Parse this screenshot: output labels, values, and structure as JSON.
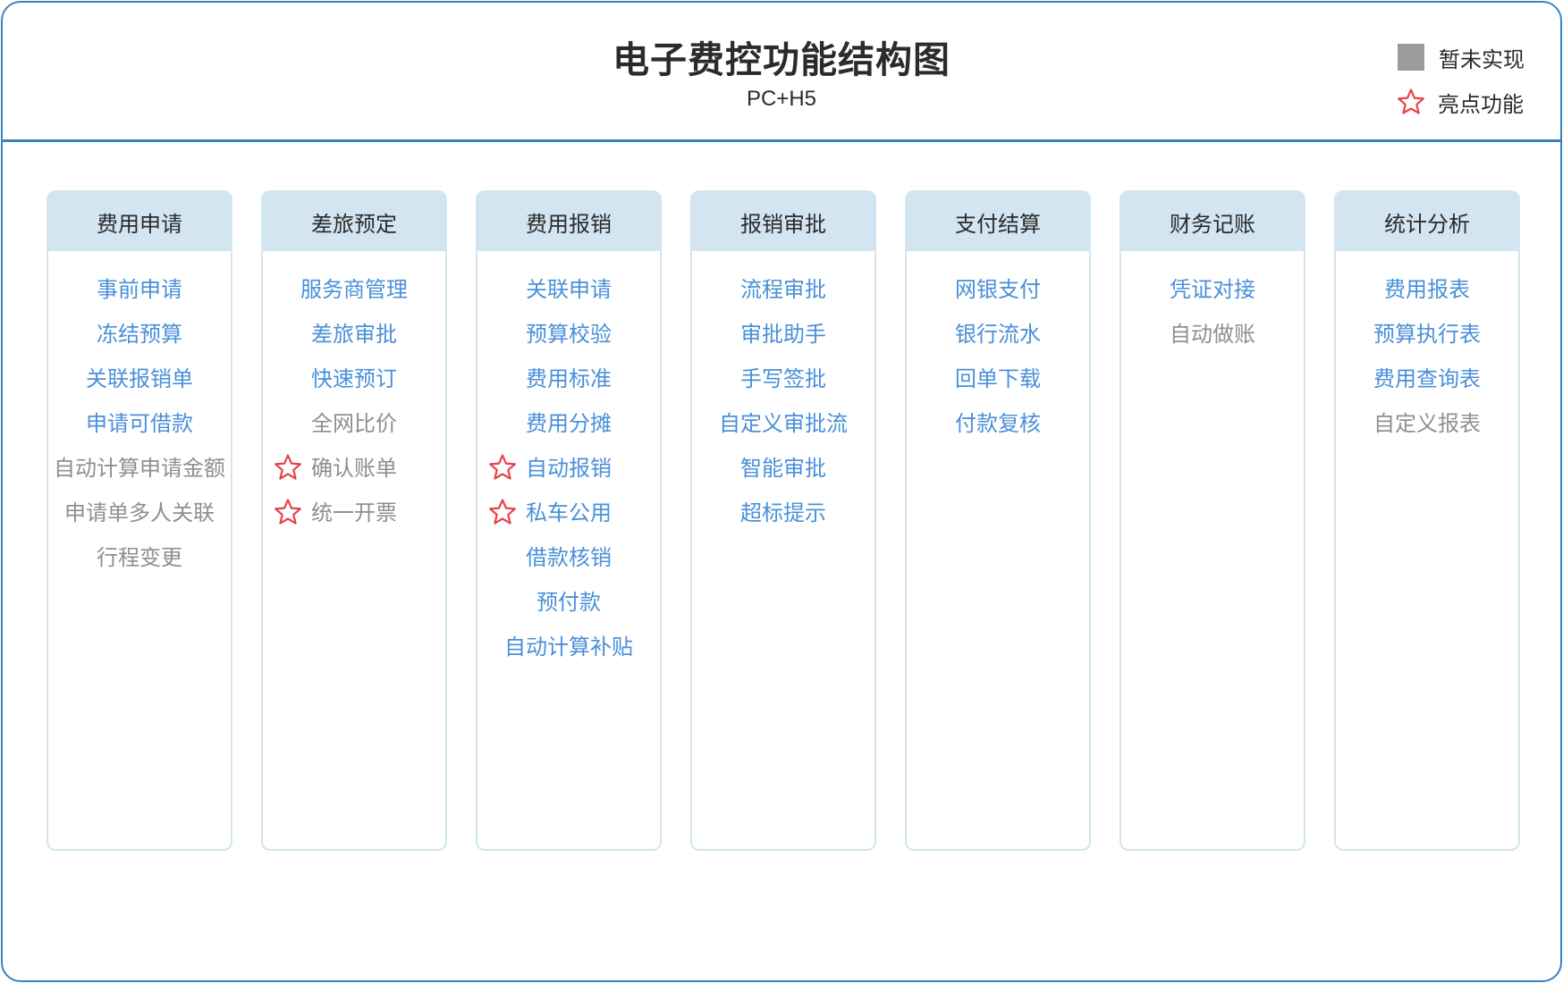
{
  "title": "电子费控功能结构图",
  "subtitle": "PC+H5",
  "legend": {
    "not_implemented": "暂未实现",
    "highlight": "亮点功能"
  },
  "colors": {
    "border": "#3a82c4",
    "column_header_bg": "#d2e5f0",
    "implemented_text": "#4a90d9",
    "not_implemented_text": "#8f8f8f",
    "not_implemented_swatch": "#9b9b9b",
    "star": "#e8414b"
  },
  "columns": [
    {
      "title": "费用申请",
      "items": [
        {
          "label": "事前申请",
          "implemented": true,
          "highlight": false
        },
        {
          "label": "冻结预算",
          "implemented": true,
          "highlight": false
        },
        {
          "label": "关联报销单",
          "implemented": true,
          "highlight": false
        },
        {
          "label": "申请可借款",
          "implemented": true,
          "highlight": false
        },
        {
          "label": "自动计算申请金额",
          "implemented": false,
          "highlight": false
        },
        {
          "label": "申请单多人关联",
          "implemented": false,
          "highlight": false
        },
        {
          "label": "行程变更",
          "implemented": false,
          "highlight": false
        }
      ]
    },
    {
      "title": "差旅预定",
      "items": [
        {
          "label": "服务商管理",
          "implemented": true,
          "highlight": false
        },
        {
          "label": "差旅审批",
          "implemented": true,
          "highlight": false
        },
        {
          "label": "快速预订",
          "implemented": true,
          "highlight": false
        },
        {
          "label": "全网比价",
          "implemented": false,
          "highlight": false
        },
        {
          "label": "确认账单",
          "implemented": false,
          "highlight": true
        },
        {
          "label": "统一开票",
          "implemented": false,
          "highlight": true
        }
      ]
    },
    {
      "title": "费用报销",
      "items": [
        {
          "label": "关联申请",
          "implemented": true,
          "highlight": false
        },
        {
          "label": "预算校验",
          "implemented": true,
          "highlight": false
        },
        {
          "label": "费用标准",
          "implemented": true,
          "highlight": false
        },
        {
          "label": "费用分摊",
          "implemented": true,
          "highlight": false
        },
        {
          "label": "自动报销",
          "implemented": true,
          "highlight": true
        },
        {
          "label": "私车公用",
          "implemented": true,
          "highlight": true
        },
        {
          "label": "借款核销",
          "implemented": true,
          "highlight": false
        },
        {
          "label": "预付款",
          "implemented": true,
          "highlight": false
        },
        {
          "label": "自动计算补贴",
          "implemented": true,
          "highlight": false
        }
      ]
    },
    {
      "title": "报销审批",
      "items": [
        {
          "label": "流程审批",
          "implemented": true,
          "highlight": false
        },
        {
          "label": "审批助手",
          "implemented": true,
          "highlight": false
        },
        {
          "label": "手写签批",
          "implemented": true,
          "highlight": false
        },
        {
          "label": "自定义审批流",
          "implemented": true,
          "highlight": false
        },
        {
          "label": "智能审批",
          "implemented": true,
          "highlight": false
        },
        {
          "label": "超标提示",
          "implemented": true,
          "highlight": false
        }
      ]
    },
    {
      "title": "支付结算",
      "items": [
        {
          "label": "网银支付",
          "implemented": true,
          "highlight": false
        },
        {
          "label": "银行流水",
          "implemented": true,
          "highlight": false
        },
        {
          "label": "回单下载",
          "implemented": true,
          "highlight": false
        },
        {
          "label": "付款复核",
          "implemented": true,
          "highlight": false
        }
      ]
    },
    {
      "title": "财务记账",
      "items": [
        {
          "label": "凭证对接",
          "implemented": true,
          "highlight": false
        },
        {
          "label": "自动做账",
          "implemented": false,
          "highlight": false
        }
      ]
    },
    {
      "title": "统计分析",
      "items": [
        {
          "label": "费用报表",
          "implemented": true,
          "highlight": false
        },
        {
          "label": "预算执行表",
          "implemented": true,
          "highlight": false
        },
        {
          "label": "费用查询表",
          "implemented": true,
          "highlight": false
        },
        {
          "label": "自定义报表",
          "implemented": false,
          "highlight": false
        }
      ]
    }
  ]
}
